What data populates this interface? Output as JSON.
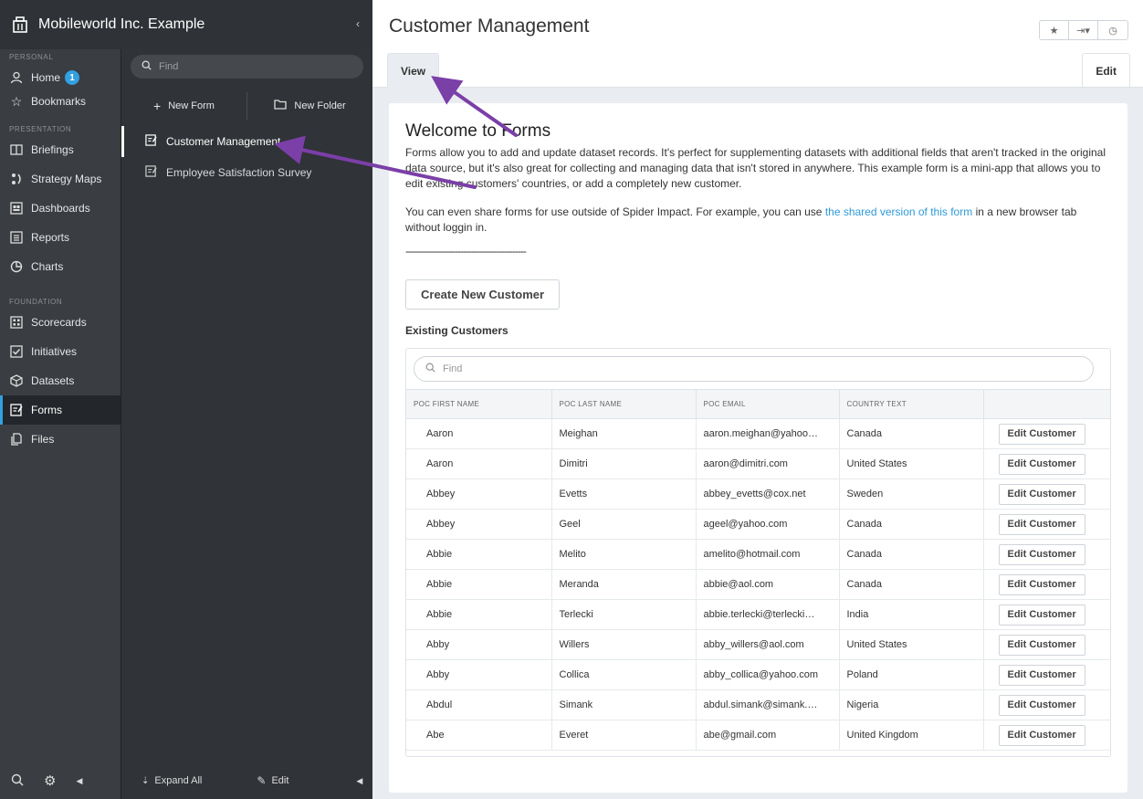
{
  "org": {
    "name": "Mobileworld Inc. Example"
  },
  "nav": {
    "sections": {
      "personal": "PERSONAL",
      "presentation": "PRESENTATION",
      "foundation": "FOUNDATION"
    },
    "items": {
      "home": "Home",
      "home_badge": "1",
      "bookmarks": "Bookmarks",
      "briefings": "Briefings",
      "strategy_maps": "Strategy Maps",
      "dashboards": "Dashboards",
      "reports": "Reports",
      "charts": "Charts",
      "scorecards": "Scorecards",
      "initiatives": "Initiatives",
      "datasets": "Datasets",
      "forms": "Forms",
      "files": "Files"
    }
  },
  "panel": {
    "search_placeholder": "Find",
    "new_form": "New Form",
    "new_folder": "New Folder",
    "items": [
      "Customer Management",
      "Employee Satisfaction Survey"
    ],
    "expand_all": "Expand All",
    "edit": "Edit"
  },
  "main": {
    "title": "Customer Management",
    "tabs": {
      "view": "View",
      "edit": "Edit"
    }
  },
  "content": {
    "welcome_title": "Welcome to Forms",
    "para1": "Forms allow you to add and update dataset records. It's perfect for supplementing datasets with additional fields that aren't tracked in the original data source, but it's also great for collecting and managing data that isn't stored in anywhere. This example form is a mini-app that allows you to edit existing customers' countries, or add a completely new customer.",
    "para2_before": "You can even share forms for use outside of Spider Impact. For example, you can use ",
    "para2_link": "the shared version of this form",
    "para2_after": " in a new browser tab without loggin in.",
    "divider": "--------------------------------------------",
    "create_button": "Create New Customer",
    "existing_label": "Existing Customers",
    "table_search_placeholder": "Find",
    "columns": [
      "POC FIRST NAME",
      "POC LAST NAME",
      "POC EMAIL",
      "COUNTRY TEXT"
    ],
    "edit_button_label": "Edit Customer",
    "rows": [
      [
        "Aaron",
        "Meighan",
        "aaron.meighan@yahoo…",
        "Canada"
      ],
      [
        "Aaron",
        "Dimitri",
        "aaron@dimitri.com",
        "United States"
      ],
      [
        "Abbey",
        "Evetts",
        "abbey_evetts@cox.net",
        "Sweden"
      ],
      [
        "Abbey",
        "Geel",
        "ageel@yahoo.com",
        "Canada"
      ],
      [
        "Abbie",
        "Melito",
        "amelito@hotmail.com",
        "Canada"
      ],
      [
        "Abbie",
        "Meranda",
        "abbie@aol.com",
        "Canada"
      ],
      [
        "Abbie",
        "Terlecki",
        "abbie.terlecki@terlecki…",
        "India"
      ],
      [
        "Abby",
        "Willers",
        "abby_willers@aol.com",
        "United States"
      ],
      [
        "Abby",
        "Collica",
        "abby_collica@yahoo.com",
        "Poland"
      ],
      [
        "Abdul",
        "Simank",
        "abdul.simank@simank.…",
        "Nigeria"
      ],
      [
        "Abe",
        "Everet",
        "abe@gmail.com",
        "United Kingdom"
      ]
    ]
  },
  "colors": {
    "accent": "#33a0e0",
    "annotation_arrow": "#7b3fa8"
  }
}
